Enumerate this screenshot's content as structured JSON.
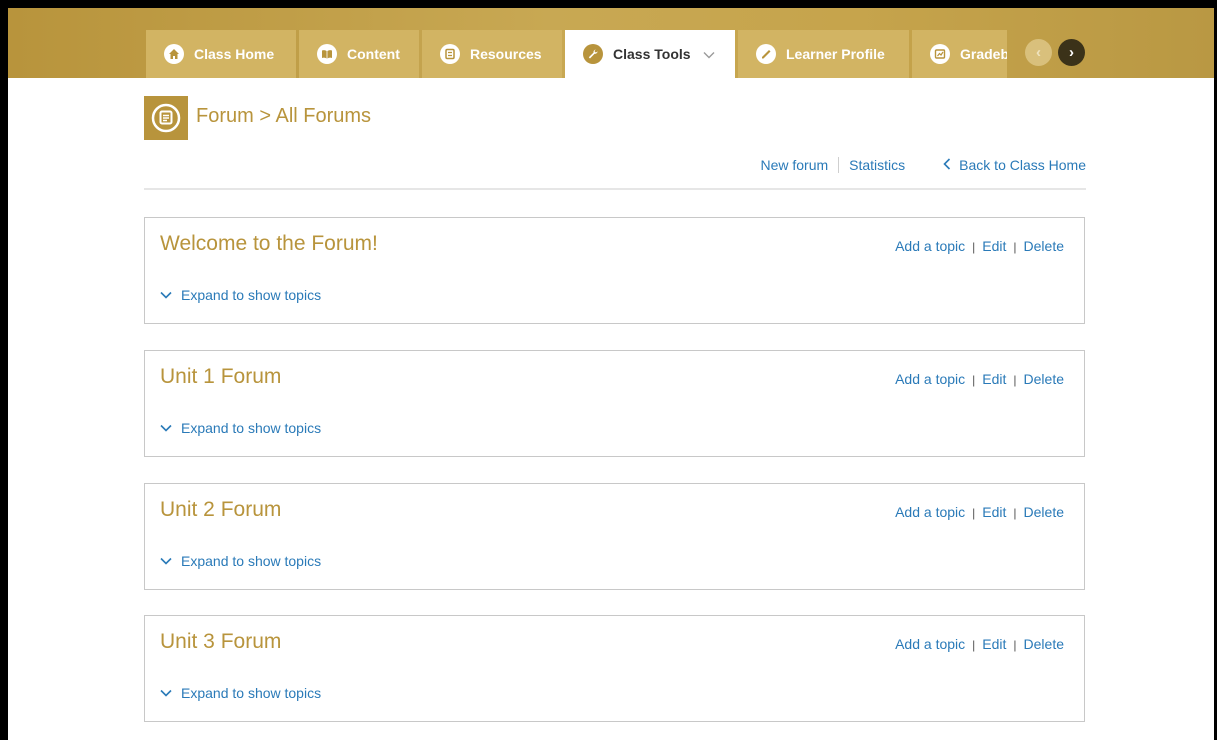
{
  "tabs": [
    {
      "label": "Class Home",
      "icon": "home-icon"
    },
    {
      "label": "Content",
      "icon": "book-icon"
    },
    {
      "label": "Resources",
      "icon": "list-icon"
    },
    {
      "label": "Class Tools",
      "icon": "wrench-icon",
      "active": true
    },
    {
      "label": "Learner Profile",
      "icon": "profile-icon"
    },
    {
      "label": "Gradebook",
      "icon": "gradebook-icon"
    }
  ],
  "nav": {
    "prev": "‹",
    "next": "›"
  },
  "page": {
    "title": "Forum > All Forums",
    "icon": "forum-icon"
  },
  "actions": {
    "new_forum": "New forum",
    "statistics": "Statistics",
    "back": "Back to Class Home"
  },
  "forums": [
    {
      "title": "Welcome to the Forum!",
      "add": "Add a topic",
      "edit": "Edit",
      "delete": "Delete",
      "expand": "Expand to show topics"
    },
    {
      "title": "Unit 1 Forum",
      "add": "Add a topic",
      "edit": "Edit",
      "delete": "Delete",
      "expand": "Expand to show topics"
    },
    {
      "title": "Unit 2 Forum",
      "add": "Add a topic",
      "edit": "Edit",
      "delete": "Delete",
      "expand": "Expand to show topics"
    },
    {
      "title": "Unit 3 Forum",
      "add": "Add a topic",
      "edit": "Edit",
      "delete": "Delete",
      "expand": "Expand to show topics"
    }
  ],
  "colors": {
    "brand": "#b8943c",
    "link": "#2a7ab8"
  }
}
